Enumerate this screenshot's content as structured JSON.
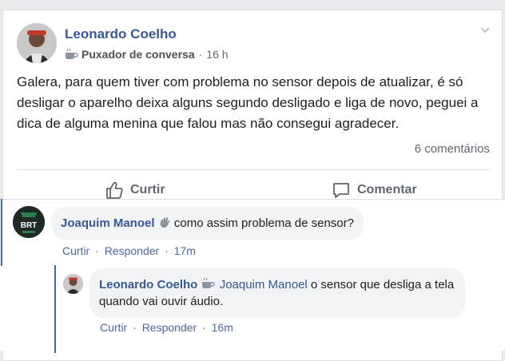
{
  "post": {
    "author": "Leonardo Coelho",
    "badge": "Puxador de conversa",
    "time": "16 h",
    "text": "Galera, para quem tiver com problema no sensor depois de atualizar, é só desligar o aparelho deixa alguns segundo desligado e liga de novo, peguei a dica de alguma menina que falou mas não consegui agradecer.",
    "comment_count": "6 comentários",
    "like_label": "Curtir",
    "comment_label": "Comentar"
  },
  "comments": [
    {
      "author": "Joaquim Manoel",
      "text": "como assim problema de sensor?",
      "like": "Curtir",
      "reply": "Responder",
      "time": "17m",
      "sep": "·",
      "avatar_text": "BRT"
    },
    {
      "author": "Leonardo Coelho",
      "tag": "Joaquim Manoel",
      "text": "o sensor que desliga a tela quando vai ouvir áudio.",
      "like": "Curtir",
      "reply": "Responder",
      "time": "16m",
      "sep": "·"
    }
  ],
  "meta_sep": "·",
  "icons": {
    "badge": "coffee-cup-icon",
    "menu": "chevron-down-icon",
    "like": "thumbs-up-icon",
    "comment": "speech-bubble-icon",
    "wave": "waving-hand-icon"
  },
  "colors": {
    "link": "#385898",
    "accent_line": "#4267b2",
    "muted": "#606770",
    "bubble": "#f2f3f5"
  }
}
